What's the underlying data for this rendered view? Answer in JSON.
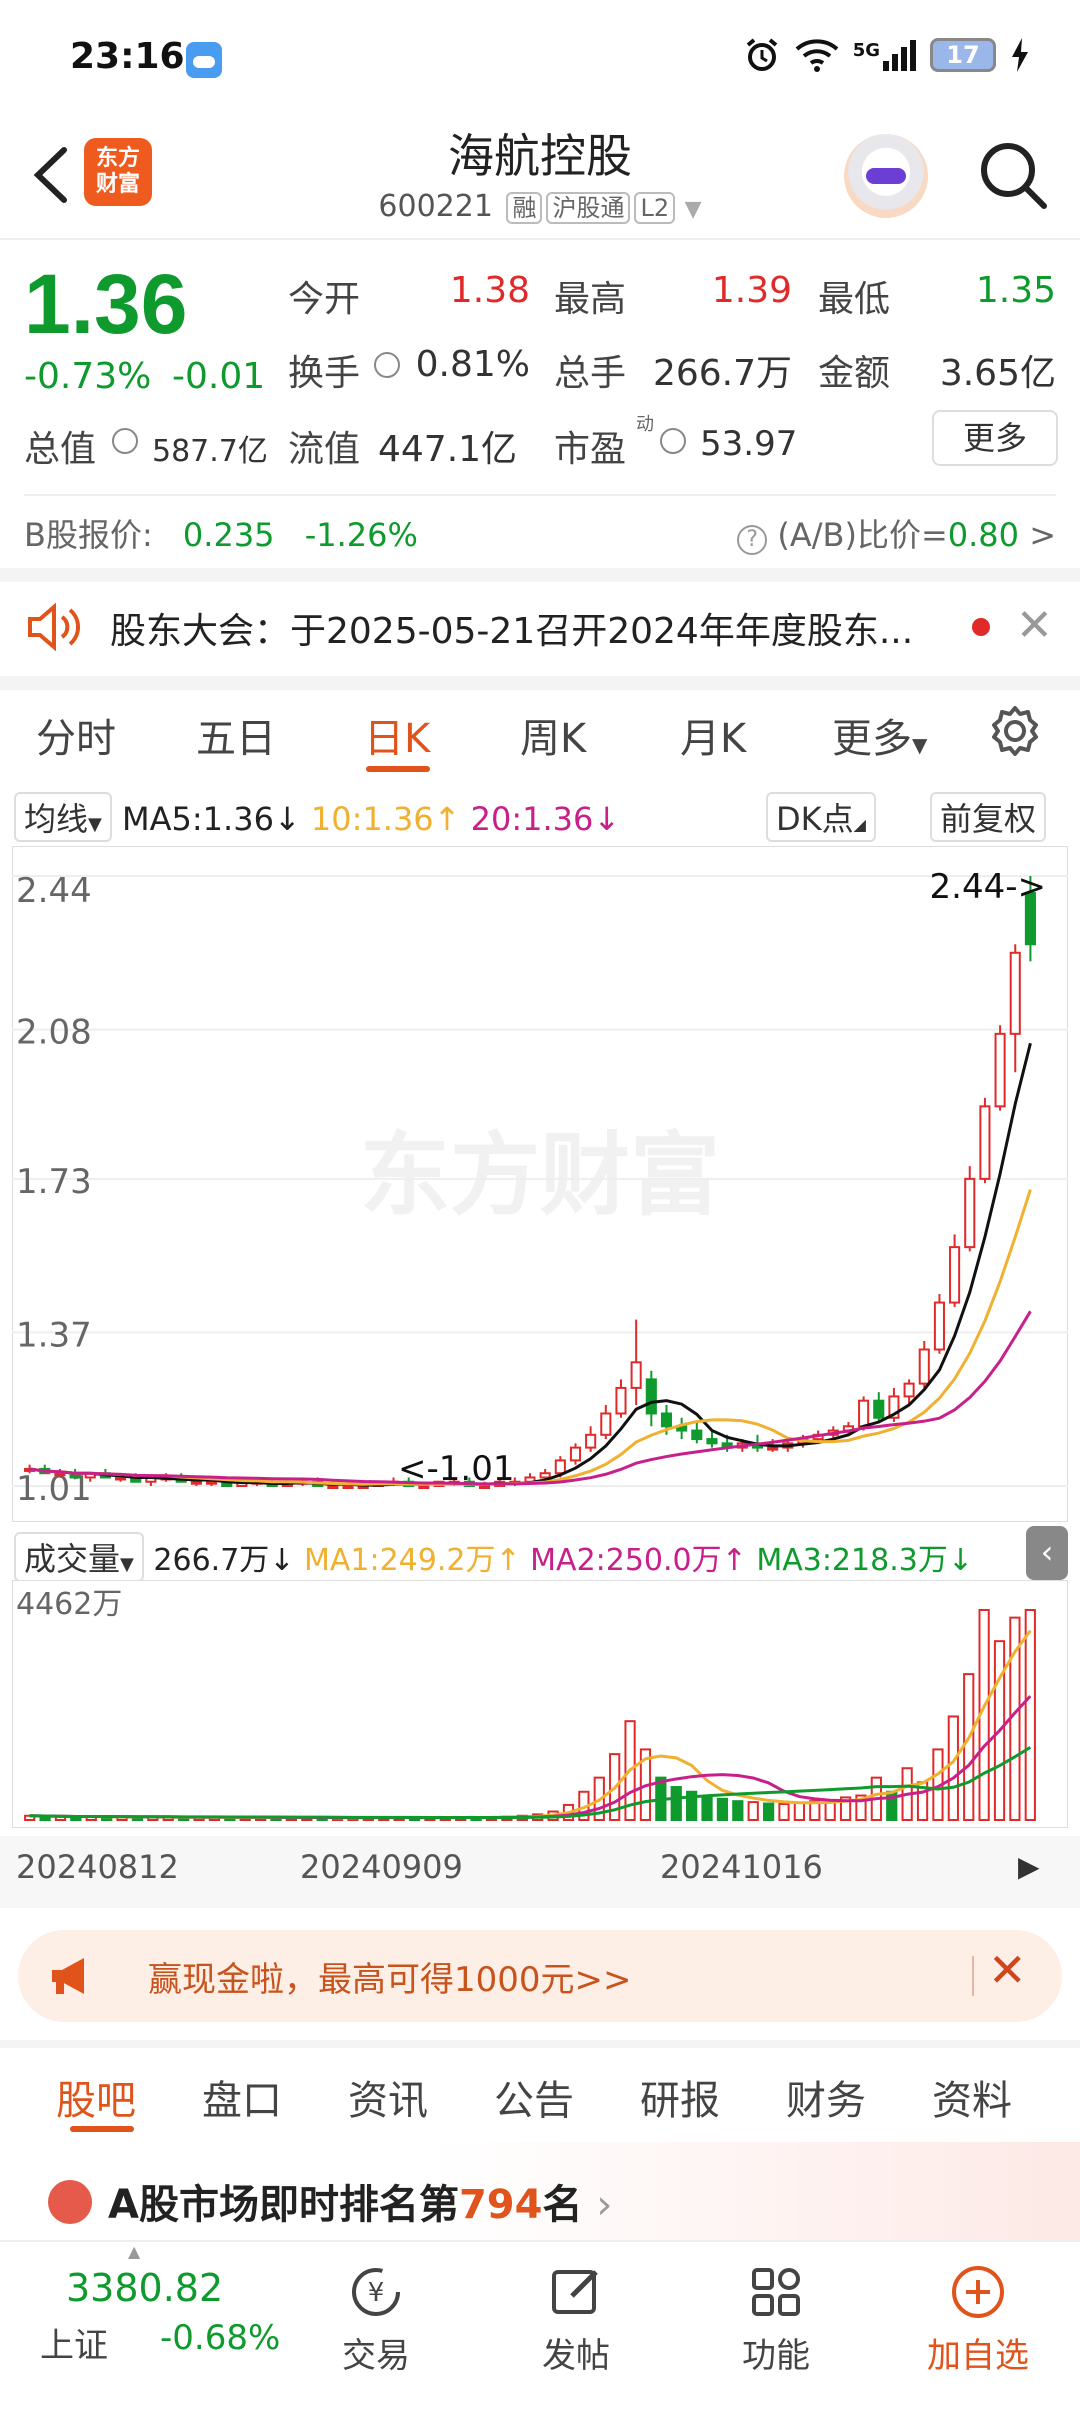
{
  "status_bar": {
    "time": "23:16",
    "signal_text": "5G",
    "battery": "17"
  },
  "header": {
    "logo_text": "东方\n财富",
    "title": "海航控股",
    "code": "600221",
    "tags": [
      "融",
      "沪股通",
      "L2"
    ]
  },
  "quote": {
    "price": "1.36",
    "change_pct": "-0.73%",
    "change_abs": "-0.01",
    "rows": [
      [
        {
          "label": "今开",
          "value": "1.38",
          "color": "red"
        },
        {
          "label": "最高",
          "value": "1.39",
          "color": "red"
        },
        {
          "label": "最低",
          "value": "1.35",
          "color": "green"
        }
      ],
      [
        {
          "label": "换手",
          "value": "0.81%",
          "color": "gray"
        },
        {
          "label": "总手",
          "value": "266.7万",
          "color": "gray"
        },
        {
          "label": "金额",
          "value": "3.65亿",
          "color": "gray"
        }
      ],
      [
        {
          "label": "总值",
          "value": "587.7亿",
          "color": "gray"
        },
        {
          "label": "流值",
          "value": "447.1亿",
          "color": "gray"
        },
        {
          "label": "市盈",
          "value": "53.97",
          "color": "gray"
        }
      ]
    ],
    "more_label": "更多",
    "b_share_label": "B股报价:",
    "b_share_price": "0.235",
    "b_share_change": "-1.26%",
    "ab_ratio_label": "(A/B)比价=",
    "ab_ratio_value": "0.80",
    "dong_mark": "动"
  },
  "notice": {
    "text": "股东大会：于2025-05-21召开2024年年度股东..."
  },
  "chart_tabs": [
    "分时",
    "五日",
    "日K",
    "周K",
    "月K",
    "更多"
  ],
  "chart_tab_active": 2,
  "ma_bar": {
    "selector": "均线",
    "ma5": "MA5:1.36",
    "ma10": "10:1.36",
    "ma20": "20:1.36",
    "dk_label": "DK点",
    "fq_label": "前复权"
  },
  "chart_labels": {
    "watermark": "东方财富",
    "high_marker": "2.44->",
    "low_marker": "<-1.01"
  },
  "chart_data": {
    "type": "candlestick",
    "y_ticks": [
      "2.44",
      "2.08",
      "1.73",
      "1.37",
      "1.01"
    ],
    "ylim": [
      1.01,
      2.44
    ],
    "x_ticks": [
      "20240812",
      "20240909",
      "20241016"
    ],
    "candles": [
      {
        "o": 1.05,
        "h": 1.06,
        "l": 1.04,
        "c": 1.05
      },
      {
        "o": 1.05,
        "h": 1.06,
        "l": 1.04,
        "c": 1.04
      },
      {
        "o": 1.04,
        "h": 1.05,
        "l": 1.03,
        "c": 1.04
      },
      {
        "o": 1.04,
        "h": 1.05,
        "l": 1.03,
        "c": 1.03
      },
      {
        "o": 1.03,
        "h": 1.04,
        "l": 1.02,
        "c": 1.04
      },
      {
        "o": 1.04,
        "h": 1.05,
        "l": 1.03,
        "c": 1.03
      },
      {
        "o": 1.03,
        "h": 1.04,
        "l": 1.02,
        "c": 1.03
      },
      {
        "o": 1.03,
        "h": 1.04,
        "l": 1.02,
        "c": 1.02
      },
      {
        "o": 1.02,
        "h": 1.03,
        "l": 1.01,
        "c": 1.03
      },
      {
        "o": 1.03,
        "h": 1.04,
        "l": 1.02,
        "c": 1.03
      },
      {
        "o": 1.03,
        "h": 1.04,
        "l": 1.02,
        "c": 1.02
      },
      {
        "o": 1.02,
        "h": 1.03,
        "l": 1.01,
        "c": 1.02
      },
      {
        "o": 1.02,
        "h": 1.03,
        "l": 1.01,
        "c": 1.02
      },
      {
        "o": 1.02,
        "h": 1.03,
        "l": 1.01,
        "c": 1.01
      },
      {
        "o": 1.01,
        "h": 1.02,
        "l": 1.01,
        "c": 1.02
      },
      {
        "o": 1.02,
        "h": 1.03,
        "l": 1.01,
        "c": 1.02
      },
      {
        "o": 1.02,
        "h": 1.03,
        "l": 1.01,
        "c": 1.01
      },
      {
        "o": 1.01,
        "h": 1.02,
        "l": 1.01,
        "c": 1.02
      },
      {
        "o": 1.02,
        "h": 1.03,
        "l": 1.01,
        "c": 1.02
      },
      {
        "o": 1.02,
        "h": 1.03,
        "l": 1.01,
        "c": 1.01
      },
      {
        "o": 1.01,
        "h": 1.02,
        "l": 1.01,
        "c": 1.01
      },
      {
        "o": 1.01,
        "h": 1.02,
        "l": 1.01,
        "c": 1.01
      },
      {
        "o": 1.01,
        "h": 1.02,
        "l": 1.01,
        "c": 1.01
      },
      {
        "o": 1.01,
        "h": 1.02,
        "l": 1.01,
        "c": 1.02
      },
      {
        "o": 1.02,
        "h": 1.03,
        "l": 1.01,
        "c": 1.02
      },
      {
        "o": 1.02,
        "h": 1.03,
        "l": 1.01,
        "c": 1.01
      },
      {
        "o": 1.01,
        "h": 1.02,
        "l": 1.01,
        "c": 1.01
      },
      {
        "o": 1.01,
        "h": 1.02,
        "l": 1.01,
        "c": 1.02
      },
      {
        "o": 1.02,
        "h": 1.03,
        "l": 1.01,
        "c": 1.02
      },
      {
        "o": 1.02,
        "h": 1.03,
        "l": 1.01,
        "c": 1.01
      },
      {
        "o": 1.01,
        "h": 1.02,
        "l": 1.01,
        "c": 1.01
      },
      {
        "o": 1.01,
        "h": 1.03,
        "l": 1.01,
        "c": 1.02
      },
      {
        "o": 1.02,
        "h": 1.03,
        "l": 1.01,
        "c": 1.02
      },
      {
        "o": 1.02,
        "h": 1.04,
        "l": 1.02,
        "c": 1.03
      },
      {
        "o": 1.03,
        "h": 1.05,
        "l": 1.02,
        "c": 1.04
      },
      {
        "o": 1.04,
        "h": 1.08,
        "l": 1.03,
        "c": 1.07
      },
      {
        "o": 1.07,
        "h": 1.11,
        "l": 1.06,
        "c": 1.1
      },
      {
        "o": 1.1,
        "h": 1.15,
        "l": 1.09,
        "c": 1.13
      },
      {
        "o": 1.13,
        "h": 1.2,
        "l": 1.12,
        "c": 1.18
      },
      {
        "o": 1.18,
        "h": 1.26,
        "l": 1.17,
        "c": 1.24
      },
      {
        "o": 1.24,
        "h": 1.4,
        "l": 1.2,
        "c": 1.3
      },
      {
        "o": 1.26,
        "h": 1.28,
        "l": 1.15,
        "c": 1.18
      },
      {
        "o": 1.18,
        "h": 1.2,
        "l": 1.13,
        "c": 1.15
      },
      {
        "o": 1.15,
        "h": 1.17,
        "l": 1.12,
        "c": 1.14
      },
      {
        "o": 1.14,
        "h": 1.16,
        "l": 1.11,
        "c": 1.12
      },
      {
        "o": 1.12,
        "h": 1.14,
        "l": 1.1,
        "c": 1.11
      },
      {
        "o": 1.11,
        "h": 1.13,
        "l": 1.09,
        "c": 1.1
      },
      {
        "o": 1.1,
        "h": 1.12,
        "l": 1.09,
        "c": 1.11
      },
      {
        "o": 1.11,
        "h": 1.13,
        "l": 1.09,
        "c": 1.1
      },
      {
        "o": 1.1,
        "h": 1.12,
        "l": 1.09,
        "c": 1.1
      },
      {
        "o": 1.1,
        "h": 1.12,
        "l": 1.09,
        "c": 1.11
      },
      {
        "o": 1.11,
        "h": 1.13,
        "l": 1.1,
        "c": 1.12
      },
      {
        "o": 1.12,
        "h": 1.14,
        "l": 1.11,
        "c": 1.13
      },
      {
        "o": 1.13,
        "h": 1.15,
        "l": 1.12,
        "c": 1.14
      },
      {
        "o": 1.14,
        "h": 1.16,
        "l": 1.13,
        "c": 1.15
      },
      {
        "o": 1.15,
        "h": 1.22,
        "l": 1.14,
        "c": 1.21
      },
      {
        "o": 1.21,
        "h": 1.23,
        "l": 1.16,
        "c": 1.17
      },
      {
        "o": 1.17,
        "h": 1.24,
        "l": 1.16,
        "c": 1.22
      },
      {
        "o": 1.22,
        "h": 1.26,
        "l": 1.2,
        "c": 1.25
      },
      {
        "o": 1.25,
        "h": 1.35,
        "l": 1.24,
        "c": 1.33
      },
      {
        "o": 1.33,
        "h": 1.46,
        "l": 1.32,
        "c": 1.44
      },
      {
        "o": 1.44,
        "h": 1.6,
        "l": 1.43,
        "c": 1.57
      },
      {
        "o": 1.57,
        "h": 1.76,
        "l": 1.56,
        "c": 1.73
      },
      {
        "o": 1.73,
        "h": 1.92,
        "l": 1.72,
        "c": 1.9
      },
      {
        "o": 1.9,
        "h": 2.09,
        "l": 1.89,
        "c": 2.07
      },
      {
        "o": 2.07,
        "h": 2.28,
        "l": 1.98,
        "c": 2.26
      },
      {
        "o": 2.4,
        "h": 2.44,
        "l": 2.24,
        "c": 2.28
      }
    ],
    "ma_colors": {
      "ma5": "#111111",
      "ma10": "#f0b030",
      "ma20": "#c8208a"
    },
    "volume": {
      "max_label": "4462万",
      "values": [
        90,
        80,
        70,
        60,
        75,
        65,
        60,
        55,
        70,
        60,
        50,
        55,
        60,
        50,
        55,
        60,
        50,
        45,
        55,
        50,
        45,
        50,
        55,
        60,
        55,
        50,
        45,
        55,
        60,
        50,
        55,
        70,
        90,
        120,
        180,
        320,
        600,
        900,
        1400,
        2100,
        1500,
        900,
        700,
        600,
        500,
        450,
        400,
        380,
        350,
        340,
        360,
        400,
        420,
        480,
        520,
        900,
        600,
        1100,
        800,
        1500,
        2200,
        3100,
        4462,
        3800,
        4300,
        4462
      ]
    }
  },
  "volume_bar": {
    "selector": "成交量",
    "value": "266.7万",
    "ma1": "MA1:249.2万",
    "ma2": "MA2:250.0万",
    "ma3": "MA3:218.3万"
  },
  "promo": {
    "text": "赢现金啦，最高可得1000元>>"
  },
  "bottom_tabs": [
    "股吧",
    "盘口",
    "资讯",
    "公告",
    "研报",
    "财务",
    "资料"
  ],
  "rank": {
    "prefix": "A股市场即时排名第",
    "number": "794",
    "suffix": "名"
  },
  "index": {
    "value": "3380.82",
    "name": "上证",
    "change": "-0.68%"
  },
  "nav": {
    "trade": "交易",
    "post": "发帖",
    "functions": "功能",
    "add_watch": "加自选"
  }
}
